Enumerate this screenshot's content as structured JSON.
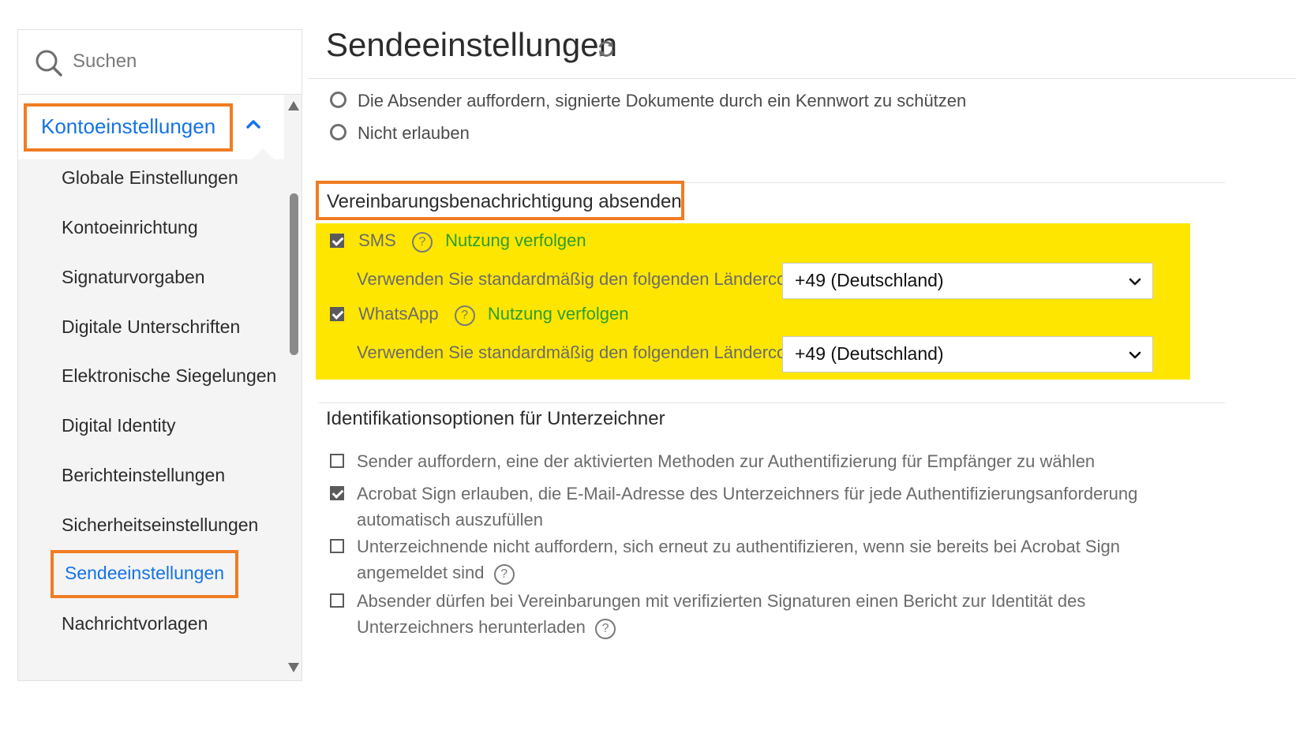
{
  "sidebar": {
    "search": {
      "placeholder": "Suchen"
    },
    "group_label": "Kontoeinstellungen",
    "items": [
      {
        "label": "Globale Einstellungen"
      },
      {
        "label": "Kontoeinrichtung"
      },
      {
        "label": "Signaturvorgaben"
      },
      {
        "label": "Digitale Unterschriften"
      },
      {
        "label": "Elektronische Siegelungen"
      },
      {
        "label": "Digital Identity"
      },
      {
        "label": "Berichteinstellungen"
      },
      {
        "label": "Sicherheitseinstellungen"
      },
      {
        "label": "Sendeeinstellungen",
        "active": true
      },
      {
        "label": "Nachrichtvorlagen"
      }
    ]
  },
  "main": {
    "title": "Sendeeinstellungen",
    "password_options": [
      {
        "label": "Die Absender auffordern, signierte Dokumente durch ein Kennwort zu schützen",
        "selected": false
      },
      {
        "label": "Nicht erlauben",
        "selected": false
      }
    ],
    "notification": {
      "heading": "Vereinbarungsbenachrichtigung absenden",
      "channels": [
        {
          "label": "SMS",
          "checked": true,
          "track_link": "Nutzung verfolgen",
          "country_label": "Verwenden Sie standardmäßig den folgenden Ländercode:",
          "country_value": "+49 (Deutschland)"
        },
        {
          "label": "WhatsApp",
          "checked": true,
          "track_link": "Nutzung verfolgen",
          "country_label": "Verwenden Sie standardmäßig den folgenden Ländercode:",
          "country_value": "+49 (Deutschland)"
        }
      ]
    },
    "identification": {
      "heading": "Identifikationsoptionen für Unterzeichner",
      "options": [
        {
          "label": "Sender auffordern, eine der aktivierten Methoden zur Authentifizierung für Empfänger zu wählen",
          "checked": false
        },
        {
          "label": "Acrobat Sign erlauben, die E-Mail-Adresse des Unterzeichners für jede Authentifizierungsanforderung automatisch auszufüllen",
          "checked": true
        },
        {
          "label": "Unterzeichnende nicht auffordern, sich erneut zu authentifizieren, wenn sie bereits bei Acrobat Sign angemeldet sind",
          "checked": false,
          "help": true
        },
        {
          "label": "Absender dürfen bei Vereinbarungen mit verifizierten Signaturen einen Bericht zur Identität des Unterzeichners herunterladen",
          "checked": false,
          "help": true
        }
      ]
    }
  },
  "colors": {
    "accent_blue": "#1473e6",
    "highlight_orange": "#f07c22",
    "highlight_yellow": "#ffe600",
    "link_green": "#2d9d2d"
  },
  "icons": [
    "search-icon",
    "chevron-up-icon",
    "refresh-icon",
    "help-icon",
    "chevron-down-icon",
    "scroll-up-icon",
    "scroll-down-icon"
  ]
}
